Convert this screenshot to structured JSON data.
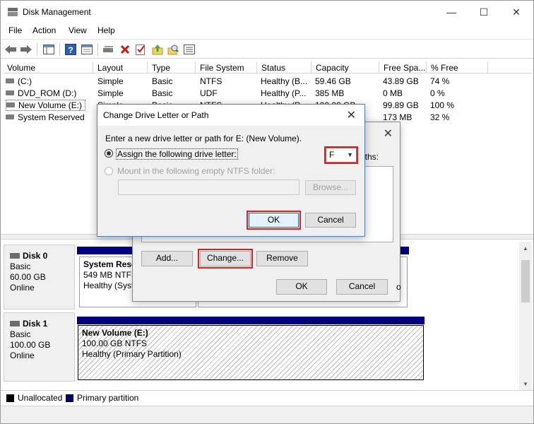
{
  "window": {
    "title": "Disk Management",
    "minimize": "—",
    "maximize": "☐",
    "close": "✕"
  },
  "menu": {
    "items": [
      "File",
      "Action",
      "View",
      "Help"
    ]
  },
  "volume_table": {
    "columns": [
      "Volume",
      "Layout",
      "Type",
      "File System",
      "Status",
      "Capacity",
      "Free Spa...",
      "% Free"
    ],
    "rows": [
      {
        "volume": "(C:)",
        "layout": "Simple",
        "type": "Basic",
        "fs": "NTFS",
        "status": "Healthy (B...",
        "capacity": "59.46 GB",
        "free": "43.89 GB",
        "pct": "74 %"
      },
      {
        "volume": "DVD_ROM (D:)",
        "layout": "Simple",
        "type": "Basic",
        "fs": "UDF",
        "status": "Healthy (P...",
        "capacity": "385 MB",
        "free": "0 MB",
        "pct": "0 %"
      },
      {
        "volume": "New Volume (E:)",
        "layout": "Simple",
        "type": "Basic",
        "fs": "NTFS",
        "status": "Healthy (P...",
        "capacity": "100.00 GB",
        "free": "99.89 GB",
        "pct": "100 %"
      },
      {
        "volume": "System Reserved",
        "layout": "",
        "type": "",
        "fs": "",
        "status": "",
        "capacity": "",
        "free": "173 MB",
        "pct": "32 %"
      }
    ]
  },
  "disks": [
    {
      "name": "Disk 0",
      "type": "Basic",
      "size": "60.00 GB",
      "status": "Online",
      "partition": {
        "name": "System Reser",
        "detail": "549 MB NTFS",
        "status": "Healthy (Syste"
      }
    },
    {
      "name": "Disk 1",
      "type": "Basic",
      "size": "100.00 GB",
      "status": "Online",
      "partition": {
        "name": "New Volume  (E:)",
        "detail": "100.00 GB NTFS",
        "status": "Healthy (Primary Partition)"
      }
    }
  ],
  "legend": {
    "unallocated": "Unallocated",
    "primary": "Primary partition",
    "unallocated_color": "#000000",
    "primary_color": "#00007f"
  },
  "dialog_paths": {
    "paths_label": "aths:",
    "add_label": "Add...",
    "change_label": "Change...",
    "remove_label": "Remove",
    "ok_label": "OK",
    "cancel_label": "Cancel",
    "cut_text": "o"
  },
  "dialog_change": {
    "title": "Change Drive Letter or Path",
    "prompt": "Enter a new drive letter or path for E: (New Volume).",
    "assign_label": "Assign the following drive letter:",
    "drive_letter": "F",
    "mount_label": "Mount in the following empty NTFS folder:",
    "browse_label": "Browse...",
    "ok_label": "OK",
    "cancel_label": "Cancel"
  },
  "colors": {
    "highlight": "#e02020",
    "partition_bar": "#00007f"
  }
}
